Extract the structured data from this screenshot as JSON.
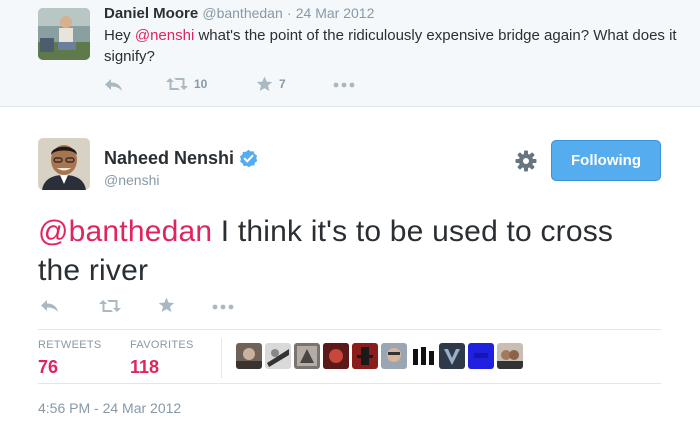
{
  "reply_tweet": {
    "author_name": "Daniel Moore",
    "author_handle": "@banthedan",
    "separator": "·",
    "date": "24 Mar 2012",
    "text_mention": "@nenshi",
    "text_before": "Hey ",
    "text_after": " what's the point of the ridiculously expensive bridge again? What does it signify?",
    "retweet_count": "10",
    "favorite_count": "7"
  },
  "main_tweet": {
    "author_name": "Naheed Nenshi",
    "author_handle": "@nenshi",
    "follow_label": "Following",
    "text_mention": "@banthedan",
    "text_after": " I think it's to be used to cross the river",
    "retweets_label": "RETWEETS",
    "retweets_value": "76",
    "favorites_label": "FAVORITES",
    "favorites_value": "118",
    "timestamp": "4:56 PM - 24 Mar 2012"
  },
  "colors": {
    "accent": "#55acee",
    "mention": "#e0245e",
    "muted": "#8899a6",
    "verified": "#55acee"
  },
  "icons": [
    "reply-icon",
    "retweet-icon",
    "favorite-icon",
    "more-icon",
    "gear-icon",
    "verified-badge-icon"
  ]
}
